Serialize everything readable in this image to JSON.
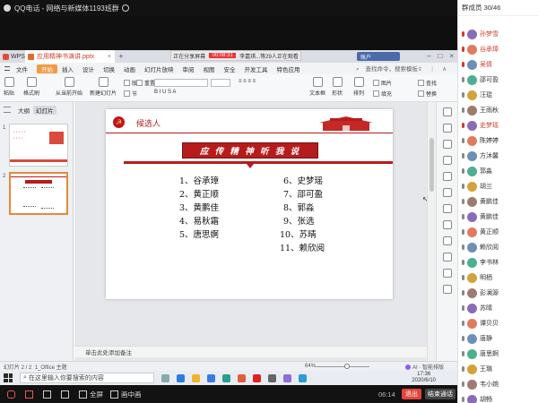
{
  "qq": {
    "title": "QQ电话 - 网络与新媒体1193班群",
    "exit_label": "退出",
    "end_label": "结束通话",
    "call_time": "06:14",
    "controls": {
      "fullscreen": "全屏",
      "picture_in_picture": "画中画"
    }
  },
  "wps": {
    "home_tab": "WPS",
    "doc_tab": "应用精神书演讲.pptx",
    "share_banner": {
      "status": "正在分享屏幕",
      "time": "00:08:31",
      "viewers": "李嘉琪...等29人正在观看"
    },
    "user": "账户",
    "menu": {
      "file": "文件",
      "items": [
        "开始",
        "插入",
        "设计",
        "切换",
        "动画",
        "幻灯片放映",
        "审阅",
        "视图",
        "安全",
        "开发工具",
        "特色应用"
      ],
      "active_index": 0,
      "search": "查找命令，搜索模板"
    },
    "ribbon": {
      "paste": "粘贴",
      "format_painter": "格式刷",
      "from_current": "从当前开始",
      "new_slide": "新建幻灯片",
      "layout": "版式",
      "section": "节",
      "reset": "重置",
      "textbox": "文本框",
      "shape": "形状",
      "arrange": "排列",
      "picture": "图片",
      "fill": "填充",
      "find": "查找",
      "replace": "替换"
    },
    "panel_tabs": {
      "outline": "大纲",
      "slides": "幻灯片"
    },
    "notes_placeholder": "单击此处添加备注",
    "status": {
      "slide_info": "幻灯片 2 / 2",
      "theme": "1_Office 主题",
      "zoom": "64%",
      "ai": "AI · 智能排版"
    }
  },
  "slide": {
    "title": "候选人",
    "banner": "应 传 精 神 听 我 说",
    "left_list": [
      "1、谷承璋",
      "2、黄正顺",
      "3、黄鹏佳",
      "4、易秋霜",
      "5、唐思婀"
    ],
    "right_list": [
      "6、史梦瑶",
      "7、邵可盈",
      "8、郭淼",
      "9、张选",
      "10、苏晴",
      "11、赖欣阅"
    ]
  },
  "windows": {
    "search_placeholder": "在这里输入你要搜索的内容",
    "time": "17:36",
    "date": "2020/6/10"
  },
  "members": {
    "header": "群成员 30/46",
    "list": [
      {
        "name": "孙梦雪",
        "highlight": true
      },
      {
        "name": "谷承璋",
        "highlight": true
      },
      {
        "name": "吴倩",
        "highlight": true
      },
      {
        "name": "邵可盈",
        "highlight": false
      },
      {
        "name": "汪琨",
        "highlight": false
      },
      {
        "name": "王雨秋",
        "highlight": false
      },
      {
        "name": "史梦瑶",
        "highlight": true
      },
      {
        "name": "陈婷婷",
        "highlight": false
      },
      {
        "name": "方沐馨",
        "highlight": false
      },
      {
        "name": "郭淼",
        "highlight": false
      },
      {
        "name": "胡兰",
        "highlight": false
      },
      {
        "name": "黄鹏佳",
        "highlight": false
      },
      {
        "name": "黄鹏佳",
        "highlight": false
      },
      {
        "name": "黄正顺",
        "highlight": false
      },
      {
        "name": "赖欣阅",
        "highlight": false
      },
      {
        "name": "李书林",
        "highlight": false
      },
      {
        "name": "明栖",
        "highlight": false
      },
      {
        "name": "彭澜源",
        "highlight": false
      },
      {
        "name": "苏晴",
        "highlight": false
      },
      {
        "name": "谭贝贝",
        "highlight": false
      },
      {
        "name": "唐静",
        "highlight": false
      },
      {
        "name": "唐思婀",
        "highlight": false
      },
      {
        "name": "王璐",
        "highlight": false
      },
      {
        "name": "韦小婉",
        "highlight": false
      },
      {
        "name": "胡畅",
        "highlight": false
      }
    ]
  }
}
